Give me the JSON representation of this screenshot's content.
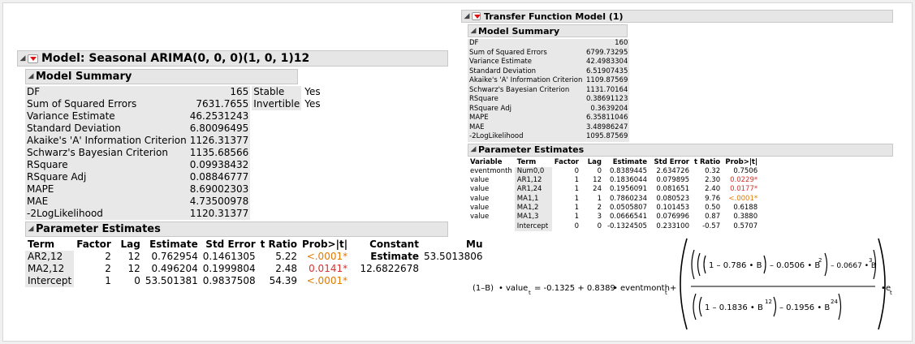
{
  "left": {
    "title": "Model: Seasonal ARIMA(0, 0, 0)(1, 0, 1)12",
    "summary_title": "Model Summary",
    "summary_rows": [
      {
        "label": "DF",
        "value": "165"
      },
      {
        "label": "Sum of Squared Errors",
        "value": "7631.7655"
      },
      {
        "label": "Variance Estimate",
        "value": "46.2531243"
      },
      {
        "label": "Standard Deviation",
        "value": "6.80096495"
      },
      {
        "label": "Akaike's 'A' Information Criterion",
        "value": "1126.31377"
      },
      {
        "label": "Schwarz's Bayesian Criterion",
        "value": "1135.68566"
      },
      {
        "label": "RSquare",
        "value": "0.09938432"
      },
      {
        "label": "RSquare Adj",
        "value": "0.08846777"
      },
      {
        "label": "MAPE",
        "value": "8.69002303"
      },
      {
        "label": "MAE",
        "value": "4.73500978"
      },
      {
        "label": "-2LogLikelihood",
        "value": "1120.31377"
      }
    ],
    "side_rows": [
      {
        "label": "Stable",
        "value": "Yes"
      },
      {
        "label": "Invertible",
        "value": "Yes"
      }
    ],
    "params_title": "Parameter Estimates",
    "params_headers": [
      "Term",
      "Factor",
      "Lag",
      "Estimate",
      "Std Error",
      "t Ratio",
      "Prob>|t|"
    ],
    "params_rows": [
      {
        "term": "AR2,12",
        "factor": "2",
        "lag": "12",
        "estimate": "0.762954",
        "stderr": "0.1461305",
        "tratio": "5.22",
        "prob": "<.0001*",
        "prob_color": "#e07a00"
      },
      {
        "term": "MA2,12",
        "factor": "2",
        "lag": "12",
        "estimate": "0.496204",
        "stderr": "0.1999804",
        "tratio": "2.48",
        "prob": "0.0141*",
        "prob_color": "#d9302c"
      },
      {
        "term": "Intercept",
        "factor": "1",
        "lag": "0",
        "estimate": "53.501381",
        "stderr": "0.9837508",
        "tratio": "54.39",
        "prob": "<.0001*",
        "prob_color": "#e07a00"
      }
    ],
    "constant_headers": [
      "Constant",
      "Mu"
    ],
    "constant_label": "Estimate",
    "constant_value": "12.6822678",
    "mu_value": "53.5013806"
  },
  "right": {
    "title": "Transfer Function Model (1)",
    "summary_title": "Model Summary",
    "summary_rows": [
      {
        "label": "DF",
        "value": "160"
      },
      {
        "label": "Sum of Squared Errors",
        "value": "6799.73295"
      },
      {
        "label": "Variance Estimate",
        "value": "42.4983304"
      },
      {
        "label": "Standard Deviation",
        "value": "6.51907435"
      },
      {
        "label": "Akaike's 'A' Information Criterion",
        "value": "1109.87569"
      },
      {
        "label": "Schwarz's Bayesian Criterion",
        "value": "1131.70164"
      },
      {
        "label": "RSquare",
        "value": "0.38691123"
      },
      {
        "label": "RSquare Adj",
        "value": "0.3639204"
      },
      {
        "label": "MAPE",
        "value": "6.35811046"
      },
      {
        "label": "MAE",
        "value": "3.48986247"
      },
      {
        "label": "-2LogLikelihood",
        "value": "1095.87569"
      }
    ],
    "params_title": "Parameter Estimates",
    "params_headers": [
      "Variable",
      "Term",
      "Factor",
      "Lag",
      "Estimate",
      "Std Error",
      "t Ratio",
      "Prob>|t|"
    ],
    "params_rows": [
      {
        "variable": "eventmonth",
        "term": "Num0,0",
        "factor": "0",
        "lag": "0",
        "estimate": "0.8389445",
        "stderr": "2.634726",
        "tratio": "0.32",
        "prob": "0.7506",
        "prob_color": "#000000"
      },
      {
        "variable": "value",
        "term": "AR1,12",
        "factor": "1",
        "lag": "12",
        "estimate": "0.1836044",
        "stderr": "0.079895",
        "tratio": "2.30",
        "prob": "0.0229*",
        "prob_color": "#d9302c"
      },
      {
        "variable": "value",
        "term": "AR1,24",
        "factor": "1",
        "lag": "24",
        "estimate": "0.1956091",
        "stderr": "0.081651",
        "tratio": "2.40",
        "prob": "0.0177*",
        "prob_color": "#d9302c"
      },
      {
        "variable": "value",
        "term": "MA1,1",
        "factor": "1",
        "lag": "1",
        "estimate": "0.7860234",
        "stderr": "0.080523",
        "tratio": "9.76",
        "prob": "<.0001*",
        "prob_color": "#e07a00"
      },
      {
        "variable": "value",
        "term": "MA1,2",
        "factor": "1",
        "lag": "2",
        "estimate": "0.0505807",
        "stderr": "0.101453",
        "tratio": "0.50",
        "prob": "0.6188",
        "prob_color": "#000000"
      },
      {
        "variable": "value",
        "term": "MA1,3",
        "factor": "1",
        "lag": "3",
        "estimate": "0.0666541",
        "stderr": "0.076996",
        "tratio": "0.87",
        "prob": "0.3880",
        "prob_color": "#000000"
      },
      {
        "variable": "",
        "term": "Intercept",
        "factor": "0",
        "lag": "0",
        "estimate": "-0.1324505",
        "stderr": "0.233100",
        "tratio": "-0.57",
        "prob": "0.5707",
        "prob_color": "#000000"
      }
    ]
  },
  "formula": {
    "lhs_1mB": "(1–B)",
    "dot": "•",
    "value": "value",
    "t": "t",
    "eq_text": "= -0.1325 + 0.8389",
    "eventmonth": "eventmonth",
    "plus": "+",
    "num_text": "1 – 0.786 • B",
    "num_b2": "– 0.0506 • B",
    "num_b3": "– 0.0667 • B",
    "den_text": "1 – 0.1836 • B",
    "den_b24": "– 0.1956 • B",
    "exp2": "2",
    "exp3": "3",
    "exp12": "12",
    "exp24": "24",
    "e": "e"
  }
}
